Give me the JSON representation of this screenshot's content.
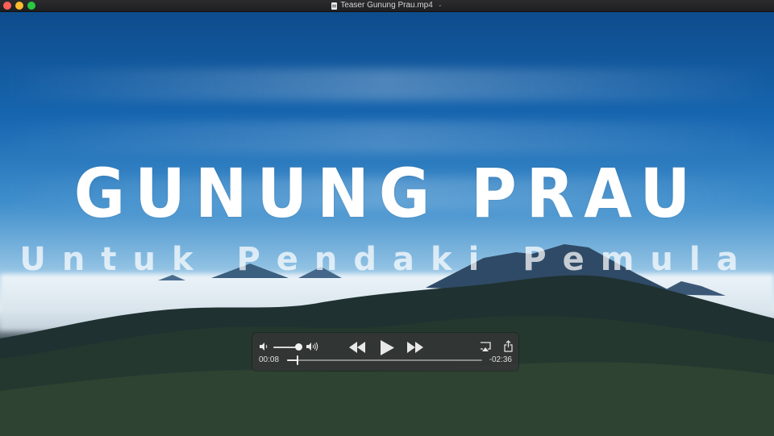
{
  "window": {
    "title": "Teaser Gunung Prau.mp4",
    "title_chevron": "⌄"
  },
  "video": {
    "title": "GUNUNG PRAU",
    "subtitle": "Untuk Pendaki Pemula"
  },
  "player": {
    "time_elapsed": "00:08",
    "time_remaining": "-02:36",
    "progress": 0.052,
    "volume": 0.8,
    "state": "paused"
  },
  "colors": {
    "close": "#ff5f57",
    "minimize": "#febc2e",
    "maximize": "#28c840"
  },
  "icons": {
    "volume_low": "speaker-low-icon",
    "volume_high": "speaker-high-icon",
    "rewind": "rewind-icon",
    "play": "play-icon",
    "fast_forward": "fast-forward-icon",
    "airplay": "airplay-icon",
    "share": "share-icon",
    "document": "document-icon"
  }
}
